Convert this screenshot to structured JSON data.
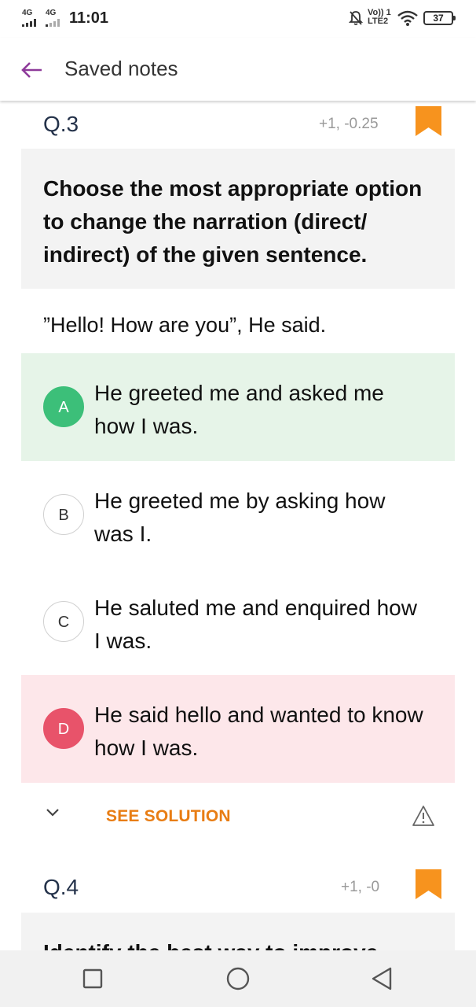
{
  "status_bar": {
    "network1": "4G",
    "network2": "4G",
    "time": "11:01",
    "volte_line1": "Vo)) 1",
    "volte_line2": "LTE2",
    "battery": "37",
    "icons": [
      "signal-icon",
      "signal-icon",
      "notifications-off-icon",
      "wifi-icon",
      "battery-icon"
    ]
  },
  "app_bar": {
    "title": "Saved notes",
    "back_icon": "arrow-left-icon",
    "accent": "#8e3a9a"
  },
  "questions": [
    {
      "number": "Q.3",
      "marks": "+1, -0.25",
      "bookmarked": true,
      "question": "Choose the most appropriate option to change the narration (direct/ indirect) of the given sentence.",
      "sentence": "”Hello! How are you”, He said.",
      "options": [
        {
          "letter": "A",
          "text": "He greeted me and asked me how I was.",
          "state": "correct"
        },
        {
          "letter": "B",
          "text": "He greeted me by asking how was I.",
          "state": "neutral"
        },
        {
          "letter": "C",
          "text": "He saluted me and enquired how I was.",
          "state": "neutral"
        },
        {
          "letter": "D",
          "text": "He said hello and wanted to know how I was.",
          "state": "wrong"
        }
      ],
      "see_solution": "SEE SOLUTION"
    },
    {
      "number": "Q.4",
      "marks": "+1, -0",
      "bookmarked": true,
      "question": "Identify the best way to improve"
    }
  ],
  "colors": {
    "bookmark": "#f7931e",
    "correct_bg": "#e6f4e8",
    "correct_badge": "#3cbf79",
    "wrong_bg": "#fde7ea",
    "wrong_badge": "#e8536a",
    "see_solution": "#e87d14"
  },
  "nav_bar": {
    "icons": [
      "recents-square-icon",
      "home-circle-icon",
      "back-triangle-icon"
    ]
  }
}
